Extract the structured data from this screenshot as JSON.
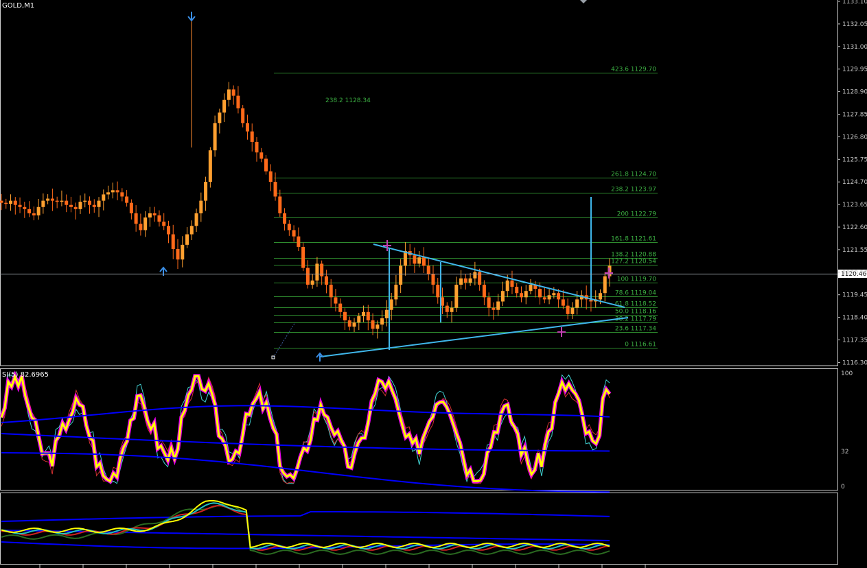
{
  "window": {
    "title": "GOLD,M1",
    "indicator_label": "SI(5) 82.6965"
  },
  "current_price": "1120.46",
  "price_axis": [
    "1133.10",
    "1132.05",
    "1131.00",
    "1129.95",
    "1128.90",
    "1127.85",
    "1126.80",
    "1125.75",
    "1124.70",
    "1123.65",
    "1122.60",
    "1121.55",
    "1120.50",
    "1119.45",
    "1118.40",
    "1117.35",
    "1116.30"
  ],
  "indicator_axis": [
    "100",
    "32",
    "0"
  ],
  "fib_levels": [
    {
      "label": "423.6 1129.70",
      "price": 1129.7
    },
    {
      "label": "261.8 1124.70",
      "price": 1124.7
    },
    {
      "label": "238.2 1123.97",
      "price": 1123.97
    },
    {
      "label": "200 1122.79",
      "price": 1122.79
    },
    {
      "label": "161.8 1121.61",
      "price": 1121.61
    },
    {
      "label": "138.2 1120.88",
      "price": 1120.88
    },
    {
      "label": "127.2 1120.54",
      "price": 1120.54
    },
    {
      "label": "100 1119.70",
      "price": 1119.7
    },
    {
      "label": "78.6 1119.04",
      "price": 1119.04
    },
    {
      "label": "61.8 1118.52",
      "price": 1118.52
    },
    {
      "label": "50.0 1118.16",
      "price": 1118.16
    },
    {
      "label": "38.2 1117.79",
      "price": 1117.79
    },
    {
      "label": "23.6 1117.34",
      "price": 1117.34
    },
    {
      "label": "0 1116.61",
      "price": 1116.61
    }
  ],
  "fib_extra_label": "238.2 1128.34",
  "colors": {
    "background": "#000000",
    "bull": "#ffa030",
    "bear": "#ff6a1a",
    "fib": "#2e8b2e",
    "trendline": "#3fb6ea",
    "arrow": "#3a8ee6",
    "marker": "#c040b0",
    "si_main": "#ffff00",
    "si_glow": "#ff00ff",
    "band": "#0000ff"
  },
  "icons": [
    "arrow-down-icon",
    "arrow-up-icon",
    "cross-marker-icon"
  ],
  "chart_data": {
    "type": "candlestick",
    "symbol": "GOLD",
    "timeframe": "M1",
    "ylim": [
      1116.3,
      1133.1
    ],
    "price_path": [
      1123.5,
      1123.45,
      1123.6,
      1123.4,
      1123.3,
      1123.2,
      1123.0,
      1122.9,
      1123.3,
      1123.6,
      1123.7,
      1123.6,
      1123.55,
      1123.6,
      1123.4,
      1123.3,
      1123.2,
      1123.55,
      1123.6,
      1123.4,
      1123.3,
      1123.6,
      1123.9,
      1124.0,
      1124.1,
      1124.0,
      1123.8,
      1123.5,
      1123.0,
      1122.5,
      1122.2,
      1122.8,
      1123.0,
      1122.9,
      1122.6,
      1122.4,
      1122.0,
      1121.3,
      1120.8,
      1121.5,
      1122.0,
      1122.4,
      1123.0,
      1123.6,
      1124.5,
      1126.0,
      1127.3,
      1127.8,
      1128.4,
      1128.9,
      1128.6,
      1128.0,
      1127.3,
      1126.9,
      1126.4,
      1125.9,
      1125.6,
      1125.0,
      1124.5,
      1123.8,
      1123.0,
      1122.5,
      1122.2,
      1121.9,
      1121.4,
      1120.4,
      1119.6,
      1119.8,
      1120.6,
      1120.0,
      1119.6,
      1119.0,
      1118.7,
      1118.3,
      1117.9,
      1117.6,
      1117.8,
      1118.1,
      1118.3,
      1117.9,
      1117.5,
      1117.7,
      1118.0,
      1118.4,
      1118.9,
      1119.6,
      1120.5,
      1121.2,
      1121.0,
      1120.6,
      1120.9,
      1120.5,
      1120.1,
      1119.6,
      1119.0,
      1118.6,
      1118.3,
      1118.5,
      1119.6,
      1119.9,
      1119.7,
      1119.9,
      1120.2,
      1119.6,
      1119.0,
      1118.5,
      1118.4,
      1118.8,
      1119.3,
      1119.8,
      1119.5,
      1119.2,
      1119.0,
      1119.3,
      1119.6,
      1119.4,
      1119.0,
      1118.9,
      1119.1,
      1119.2,
      1118.9,
      1118.6,
      1118.2,
      1118.5,
      1118.9,
      1119.1,
      1118.9,
      1118.8,
      1118.9,
      1119.2,
      1120.0,
      1120.5
    ]
  }
}
